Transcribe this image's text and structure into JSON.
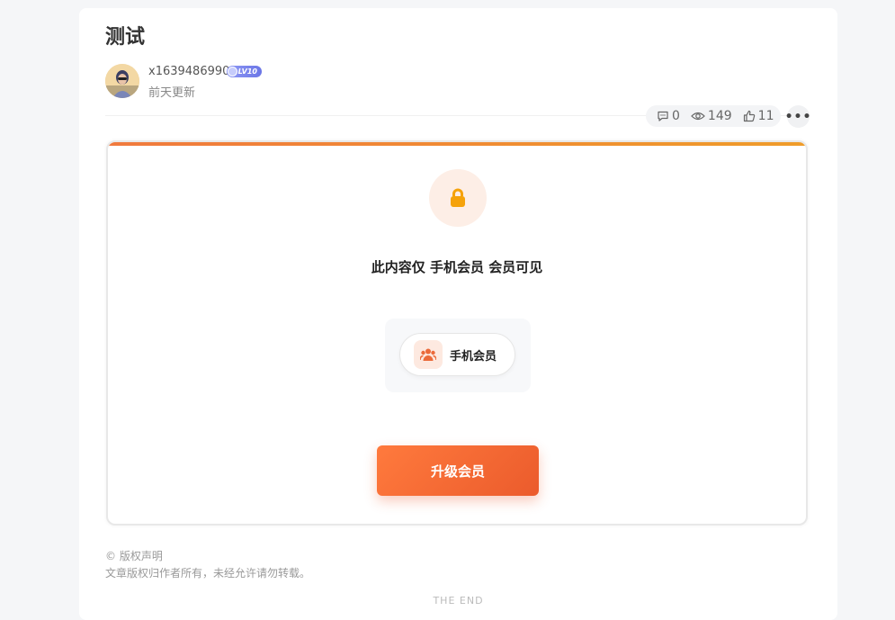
{
  "post": {
    "title": "测试",
    "author_name": "x1639486990",
    "level_badge": "LV10",
    "update_time": "前天更新"
  },
  "stats": {
    "comments": "0",
    "views": "149",
    "likes": "11",
    "more_label": "•••"
  },
  "locked": {
    "notice": "此内容仅 手机会员 会员可见",
    "role_name": "手机会员",
    "upgrade_label": "升级会员"
  },
  "footer": {
    "copyright_title": "© 版权声明",
    "copyright_text": "文章版权归作者所有，未经允许请勿转载。",
    "end_text": "THE END"
  },
  "icons": {
    "comment": "comment-icon",
    "view": "eye-icon",
    "like": "thumbs-up-icon",
    "lock": "lock-icon",
    "role": "users-icon"
  },
  "colors": {
    "accent": "#eb5b2c",
    "accent_light": "#fdeee6",
    "lock": "#f5a20b",
    "badge": "#6b76e6"
  }
}
